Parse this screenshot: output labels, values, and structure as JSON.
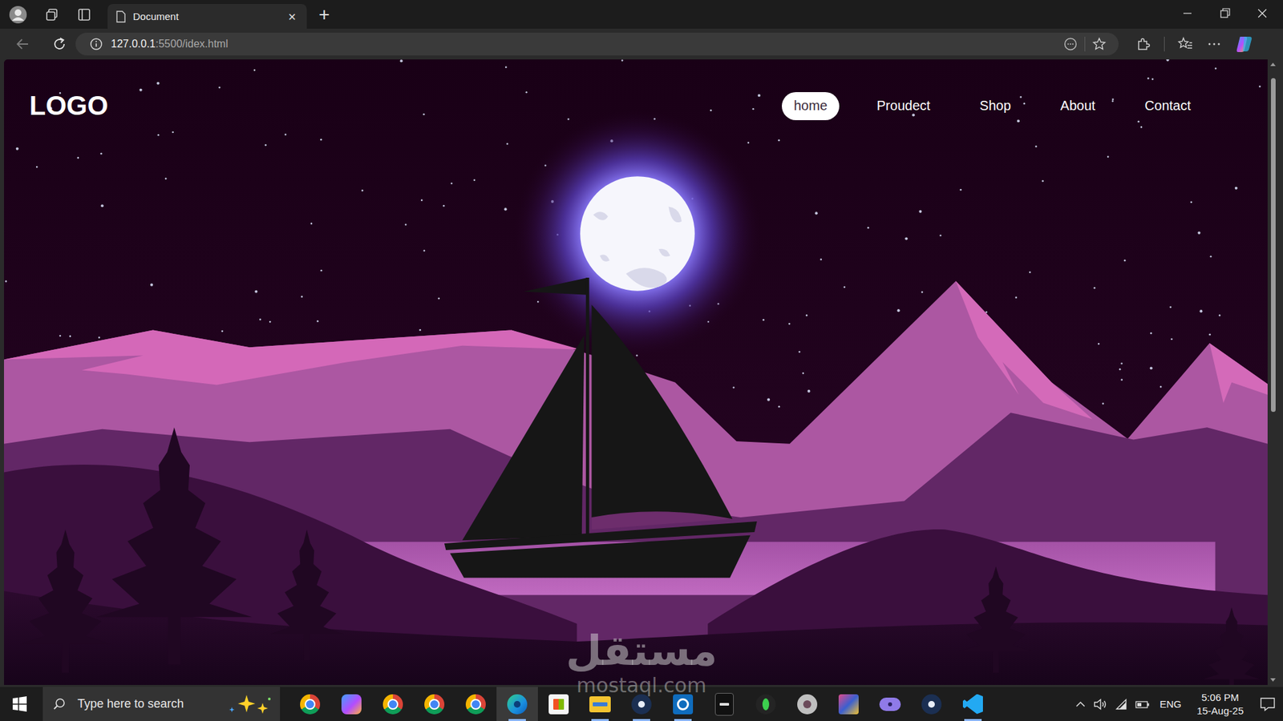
{
  "window": {
    "title": "Document"
  },
  "browser": {
    "tabs": [
      {
        "label": "Document",
        "selected": true
      }
    ],
    "tab_close": "×",
    "new_tab": "+",
    "back_disabled": true,
    "address": {
      "host": "127.0.0.1",
      "path": ":5500/idex.html"
    }
  },
  "page": {
    "logo": "LOGO",
    "nav": [
      {
        "label": "home",
        "selected": true
      },
      {
        "label": "Proudect",
        "selected": false
      },
      {
        "label": "Shop",
        "selected": false
      },
      {
        "label": "About",
        "selected": false
      },
      {
        "label": "Contact",
        "selected": false
      }
    ]
  },
  "watermark": {
    "arabic": "مستقل",
    "latin": "mostaql.com"
  },
  "taskbar": {
    "search_placeholder": "Type here to search",
    "apps": [
      {
        "kind": "chrome",
        "active": false,
        "running": false
      },
      {
        "kind": "copilot",
        "active": false,
        "running": false
      },
      {
        "kind": "chrome",
        "active": false,
        "running": false
      },
      {
        "kind": "chrome",
        "active": false,
        "running": false
      },
      {
        "kind": "chrome",
        "active": false,
        "running": false
      },
      {
        "kind": "edge",
        "active": true,
        "running": true
      },
      {
        "kind": "store",
        "active": false,
        "running": false
      },
      {
        "kind": "explorer",
        "active": false,
        "running": true
      },
      {
        "kind": "steam",
        "active": false,
        "running": true
      },
      {
        "kind": "outlook",
        "active": false,
        "running": true
      },
      {
        "kind": "epic",
        "active": false,
        "running": false
      },
      {
        "kind": "sims",
        "active": false,
        "running": false
      },
      {
        "kind": "app",
        "active": false,
        "running": false
      },
      {
        "kind": "game",
        "active": false,
        "running": false
      },
      {
        "kind": "controller",
        "active": false,
        "running": false
      },
      {
        "kind": "steam",
        "active": false,
        "running": false
      },
      {
        "kind": "vscode",
        "active": false,
        "running": true
      }
    ],
    "language": "ENG",
    "time": "5:06 PM",
    "date": "15-Aug-25"
  }
}
